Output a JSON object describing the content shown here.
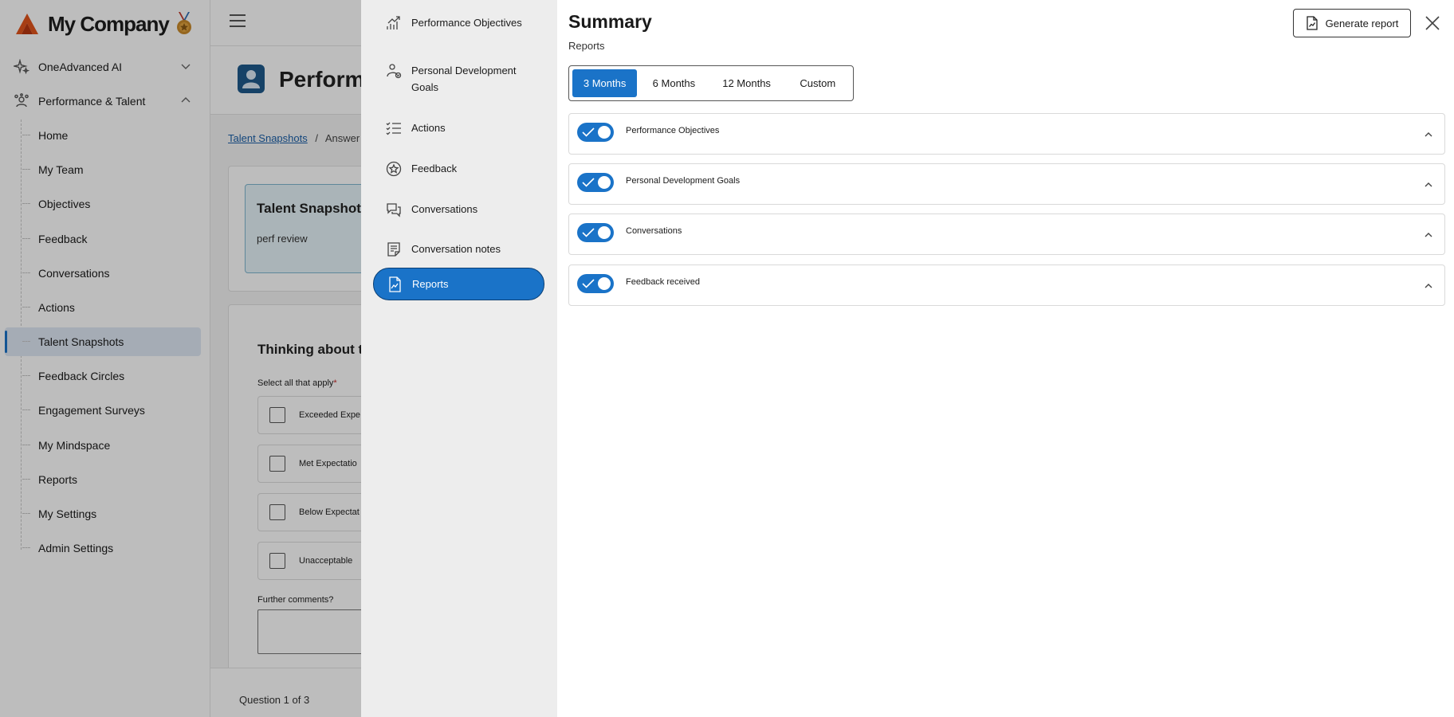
{
  "brand": {
    "name": "My Company"
  },
  "sidebar": {
    "groups": [
      {
        "label": "OneAdvanced AI"
      },
      {
        "label": "Performance & Talent"
      }
    ],
    "items": [
      {
        "label": "Home"
      },
      {
        "label": "My Team"
      },
      {
        "label": "Objectives"
      },
      {
        "label": "Feedback"
      },
      {
        "label": "Conversations"
      },
      {
        "label": "Actions"
      },
      {
        "label": "Talent Snapshots"
      },
      {
        "label": "Feedback Circles"
      },
      {
        "label": "Engagement Surveys"
      },
      {
        "label": "My Mindspace"
      },
      {
        "label": "Reports"
      },
      {
        "label": "My Settings"
      },
      {
        "label": "Admin Settings"
      }
    ],
    "active_item": "Talent Snapshots"
  },
  "main": {
    "page_title": "Performa",
    "breadcrumb": {
      "link": "Talent Snapshots",
      "separator": "/",
      "current": "Answer Ta"
    },
    "snapshot": {
      "title": "Talent Snapshots",
      "subtitle": "perf review"
    },
    "question": {
      "title": "Thinking about t",
      "hint": "Select all that apply",
      "required_mark": "*",
      "options": [
        {
          "label": "Exceeded Expe"
        },
        {
          "label": "Met Expectatio"
        },
        {
          "label": "Below Expectat"
        },
        {
          "label": "Unacceptable"
        }
      ],
      "comments_label": "Further comments?"
    },
    "footer": {
      "question_counter": "Question 1 of 3"
    }
  },
  "panel_nav": {
    "items": [
      {
        "label": "Performance Objectives",
        "icon": "chart-up-icon"
      },
      {
        "label": "Personal Development Goals",
        "icon": "person-growth-icon"
      },
      {
        "label": "Actions",
        "icon": "checklist-icon"
      },
      {
        "label": "Feedback",
        "icon": "star-badge-icon"
      },
      {
        "label": "Conversations",
        "icon": "chat-bubbles-icon"
      },
      {
        "label": "Conversation notes",
        "icon": "notes-icon"
      },
      {
        "label": "Reports",
        "icon": "report-chart-icon"
      }
    ],
    "active_item": "Reports"
  },
  "summary": {
    "title": "Summary",
    "subtitle": "Reports",
    "generate_label": "Generate report",
    "periods": [
      {
        "label": "3 Months",
        "selected": true
      },
      {
        "label": "6 Months",
        "selected": false
      },
      {
        "label": "12 Months",
        "selected": false
      },
      {
        "label": "Custom",
        "selected": false
      }
    ],
    "sections": [
      {
        "label": "Performance Objectives",
        "enabled": true,
        "expanded": true
      },
      {
        "label": "Personal Development Goals",
        "enabled": true,
        "expanded": true
      },
      {
        "label": "Conversations",
        "enabled": true,
        "expanded": true
      },
      {
        "label": "Feedback received",
        "enabled": true,
        "expanded": true
      }
    ]
  },
  "colors": {
    "accent": "#1a73c8",
    "active_nav_bg": "#dfe9f5",
    "panel_nav_bg": "#ededed",
    "brand_orange": "#e2541c"
  }
}
